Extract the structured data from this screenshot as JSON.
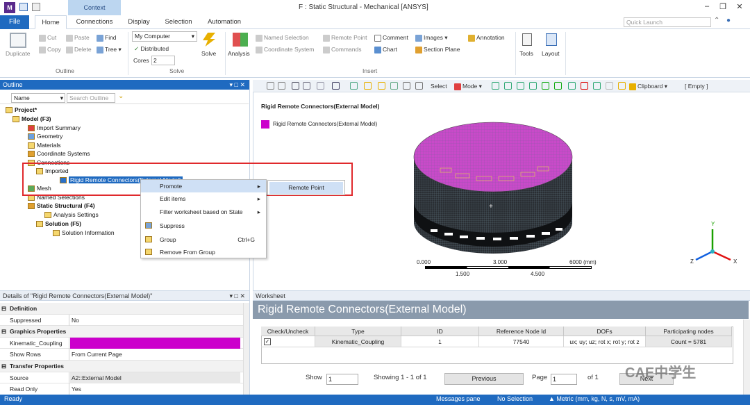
{
  "window": {
    "title": "F : Static Structural - Mechanical [ANSYS]",
    "logo": "M",
    "context_tab": "Context",
    "quick_launch_placeholder": "Quick Launch"
  },
  "ribbon_tabs": [
    "File",
    "Home",
    "Connections",
    "Display",
    "Selection",
    "Automation"
  ],
  "ribbon": {
    "outline_group": {
      "label": "Outline",
      "duplicate": "Duplicate",
      "cut": "Cut",
      "copy": "Copy",
      "paste": "Paste",
      "delete": "Delete",
      "find": "Find",
      "tree": "Tree"
    },
    "solve_group": {
      "label": "Solve",
      "computer": "My Computer",
      "distributed": "Distributed",
      "cores_label": "Cores",
      "cores_value": "2",
      "solve": "Solve"
    },
    "insert_group": {
      "label": "Insert",
      "analysis": "Analysis",
      "named_selection": "Named Selection",
      "remote_point": "Remote Point",
      "comment": "Comment",
      "images": "Images",
      "annotation": "Annotation",
      "coordinate_system": "Coordinate System",
      "commands": "Commands",
      "chart": "Chart",
      "section_plane": "Section Plane"
    },
    "tools": "Tools",
    "layout": "Layout"
  },
  "outline": {
    "title": "Outline",
    "filter_name": "Name",
    "search_placeholder": "Search Outline",
    "tree": [
      {
        "label": "Project*",
        "bold": true
      },
      {
        "label": "Model (F3)",
        "bold": true
      },
      {
        "label": "Import Summary"
      },
      {
        "label": "Geometry"
      },
      {
        "label": "Materials"
      },
      {
        "label": "Coordinate Systems"
      },
      {
        "label": "Connections"
      },
      {
        "label": "Imported"
      },
      {
        "label": "Rigid Remote Connectors(External Model)"
      },
      {
        "label": "Mesh"
      },
      {
        "label": "Named Selections"
      },
      {
        "label": "Static Structural (F4)",
        "bold": true
      },
      {
        "label": "Analysis Settings"
      },
      {
        "label": "Solution (F5)",
        "bold": true
      },
      {
        "label": "Solution Information"
      }
    ]
  },
  "context_menu": {
    "items": [
      {
        "label": "Promote",
        "arrow": true
      },
      {
        "label": "Edit items",
        "arrow": true
      },
      {
        "label": "Filter worksheet based on State",
        "arrow": true
      },
      {
        "label": "Suppress"
      },
      {
        "label": "Group",
        "shortcut": "Ctrl+G"
      },
      {
        "label": "Remove From Group"
      }
    ],
    "submenu": [
      "Remote Point"
    ]
  },
  "graphics": {
    "toolbar": {
      "select": "Select",
      "mode": "Mode",
      "clipboard": "Clipboard",
      "empty": "[ Empty ]"
    },
    "title": "Rigid Remote Connectors(External Model)",
    "legend_label": "Rigid Remote Connectors(External Model)",
    "legend_color": "#cc00cc",
    "scale": {
      "ticks_top": [
        "0.000",
        "3.000",
        "6000 (mm)"
      ],
      "ticks_bottom": [
        "1.500",
        "4.500"
      ]
    },
    "axes": [
      "Y",
      "Z",
      "X"
    ]
  },
  "details": {
    "title": "Details of \"Rigid Remote Connectors(External Model)\"",
    "rows": [
      {
        "type": "section",
        "label": "Definition"
      },
      {
        "k": "Suppressed",
        "v": "No"
      },
      {
        "type": "section",
        "label": "Graphics Properties"
      },
      {
        "k": "Kinematic_Coupling",
        "v": "",
        "color": "#cc00cc"
      },
      {
        "k": "Show Rows",
        "v": "From Current Page"
      },
      {
        "type": "section",
        "label": "Transfer Properties"
      },
      {
        "k": "Source",
        "v": "A2::External Model"
      },
      {
        "k": "Read Only",
        "v": "Yes"
      }
    ]
  },
  "worksheet": {
    "panel_title": "Worksheet",
    "title": "Rigid Remote Connectors(External Model)",
    "columns": [
      "Check/Uncheck",
      "Type",
      "ID",
      "Reference Node Id",
      "DOFs",
      "Participating nodes"
    ],
    "rows": [
      {
        "checked": true,
        "type": "Kinematic_Coupling",
        "id": "1",
        "ref": "77540",
        "dofs": "ux; uy; uz; rot x; rot y; rot z",
        "nodes": "Count = 5781"
      }
    ],
    "pager": {
      "show_label": "Show",
      "show_value": "1",
      "showing": "Showing 1 - 1 of 1",
      "previous": "Previous",
      "page_label": "Page",
      "page_value": "1",
      "of": "of 1",
      "next": "Next"
    },
    "watermark": "CAE中学生"
  },
  "status": {
    "ready": "Ready",
    "messages": "Messages pane",
    "selection": "No Selection",
    "units": "Metric (mm, kg, N, s, mV, mA)"
  }
}
